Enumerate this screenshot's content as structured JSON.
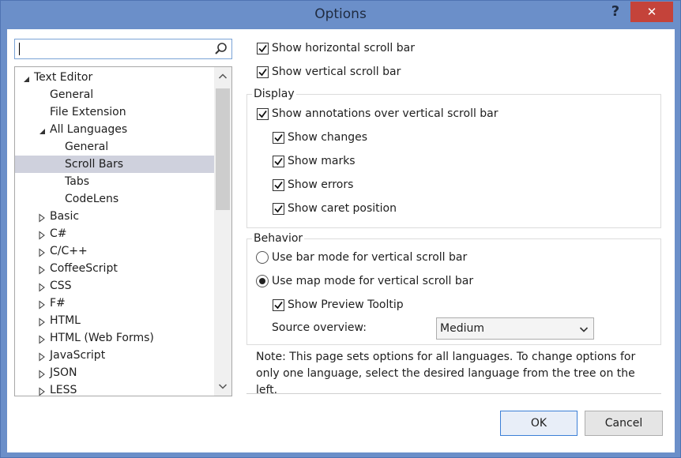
{
  "window": {
    "title": "Options",
    "help": "?",
    "close": "✕"
  },
  "search": {
    "value": "",
    "placeholder": ""
  },
  "tree": {
    "items": [
      {
        "label": "Text Editor",
        "expanded": true
      },
      {
        "label": "General"
      },
      {
        "label": "File Extension"
      },
      {
        "label": "All Languages",
        "expanded": true
      },
      {
        "label": "General"
      },
      {
        "label": "Scroll Bars",
        "selected": true
      },
      {
        "label": "Tabs"
      },
      {
        "label": "CodeLens"
      },
      {
        "label": "Basic"
      },
      {
        "label": "C#"
      },
      {
        "label": "C/C++"
      },
      {
        "label": "CoffeeScript"
      },
      {
        "label": "CSS"
      },
      {
        "label": "F#"
      },
      {
        "label": "HTML"
      },
      {
        "label": "HTML (Web Forms)"
      },
      {
        "label": "JavaScript"
      },
      {
        "label": "JSON"
      },
      {
        "label": "LESS"
      }
    ]
  },
  "options": {
    "show_horizontal": "Show horizontal scroll bar",
    "show_vertical": "Show vertical scroll bar",
    "display_title": "Display",
    "show_annotations": "Show annotations over vertical scroll bar",
    "show_changes": "Show changes",
    "show_marks": "Show marks",
    "show_errors": "Show errors",
    "show_caret": "Show caret position",
    "behavior_title": "Behavior",
    "bar_mode": "Use bar mode for vertical scroll bar",
    "map_mode": "Use map mode for vertical scroll bar",
    "preview_tooltip": "Show Preview Tooltip",
    "source_overview_label": "Source overview:",
    "source_overview_value": "Medium"
  },
  "note": "Note: This page sets options for all languages. To change options for only one language, select the desired language from the tree on the left.",
  "buttons": {
    "ok": "OK",
    "cancel": "Cancel"
  },
  "colors": {
    "title_bar": "#6b8fc9",
    "close": "#c4433a",
    "selection": "#cfd1dd"
  }
}
